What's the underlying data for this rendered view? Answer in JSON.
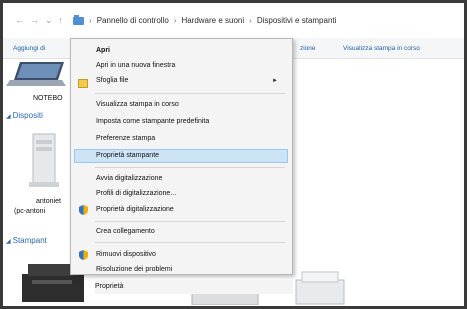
{
  "address_bar": {
    "back": "←",
    "forward": "→",
    "dropdown": "⌄",
    "up": "↑",
    "crumbs": [
      "Pannello di controllo",
      "Hardware e suoni",
      "Dispositivi e stampanti"
    ],
    "separator": "›"
  },
  "command_bar": {
    "add_device": "Aggiungi di",
    "fragment_zione": "zazione",
    "fragment_zione2": "zione",
    "view_print_queue": "Visualizza stampa in corso"
  },
  "content": {
    "laptop_label": "NOTEBO",
    "devices_header": "Dispositi",
    "device_name": "antoniet",
    "device_host": "(pc-antoni",
    "printers_header": "Stampant"
  },
  "context_menu": {
    "items": [
      {
        "label": "Apri",
        "bold": true
      },
      {
        "label": "Apri in una nuova finestra"
      },
      {
        "label": "Sfoglia file",
        "submenu": true,
        "icon": "folder-icon"
      },
      {
        "label": "Visualizza stampa in corso"
      },
      {
        "label": "Imposta come stampante predefinita"
      },
      {
        "label": "Preferenze stampa"
      },
      {
        "label": "Proprietà stampante",
        "highlighted": true
      },
      {
        "label": "Avvia digitalizzazione"
      },
      {
        "label": "Profili di digitalizzazione..."
      },
      {
        "label": "Proprietà digitalizzazione",
        "icon": "shield-icon"
      },
      {
        "label": "Crea collegamento"
      },
      {
        "label": "Rimuovi dispositivo",
        "icon": "shield-icon"
      },
      {
        "label": "Risoluzione dei problemi"
      },
      {
        "label": "Proprietà"
      }
    ]
  },
  "colors": {
    "link_blue": "#2e67b1",
    "highlight": "#cde4f7",
    "highlight_border": "#99c7ee"
  }
}
